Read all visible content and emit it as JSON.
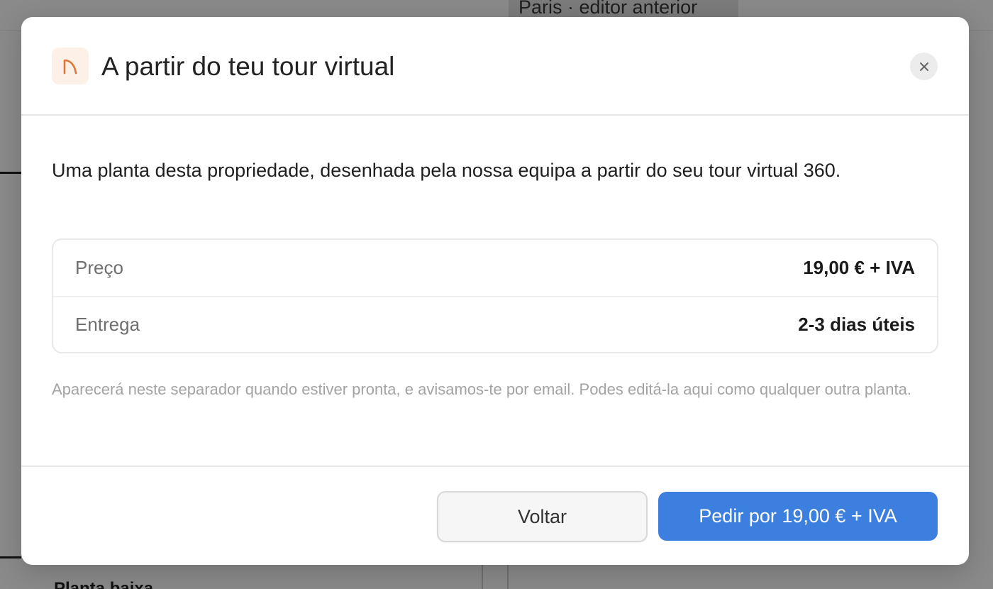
{
  "background": {
    "chip_text": "Paris · editor anterior",
    "bottom_text": "Planta baixa"
  },
  "modal": {
    "title": "A partir do teu tour virtual",
    "icon": "arch-icon",
    "close_icon": "close-icon",
    "lead": "Uma planta desta propriedade, desenhada pela nossa equipa a partir do seu tour virtual 360.",
    "details": [
      {
        "label": "Preço",
        "value": "19,00 € + IVA"
      },
      {
        "label": "Entrega",
        "value": "2-3 dias úteis"
      }
    ],
    "note": "Aparecerá neste separador quando estiver pronta, e avisamos-te por email. Podes editá-la aqui como qualquer outra planta.",
    "buttons": {
      "back": "Voltar",
      "order": "Pedir por 19,00 € + IVA"
    }
  },
  "colors": {
    "accent": "#3d7fdf",
    "icon_accent": "#e0733a",
    "icon_bg": "#fdf0e6"
  }
}
